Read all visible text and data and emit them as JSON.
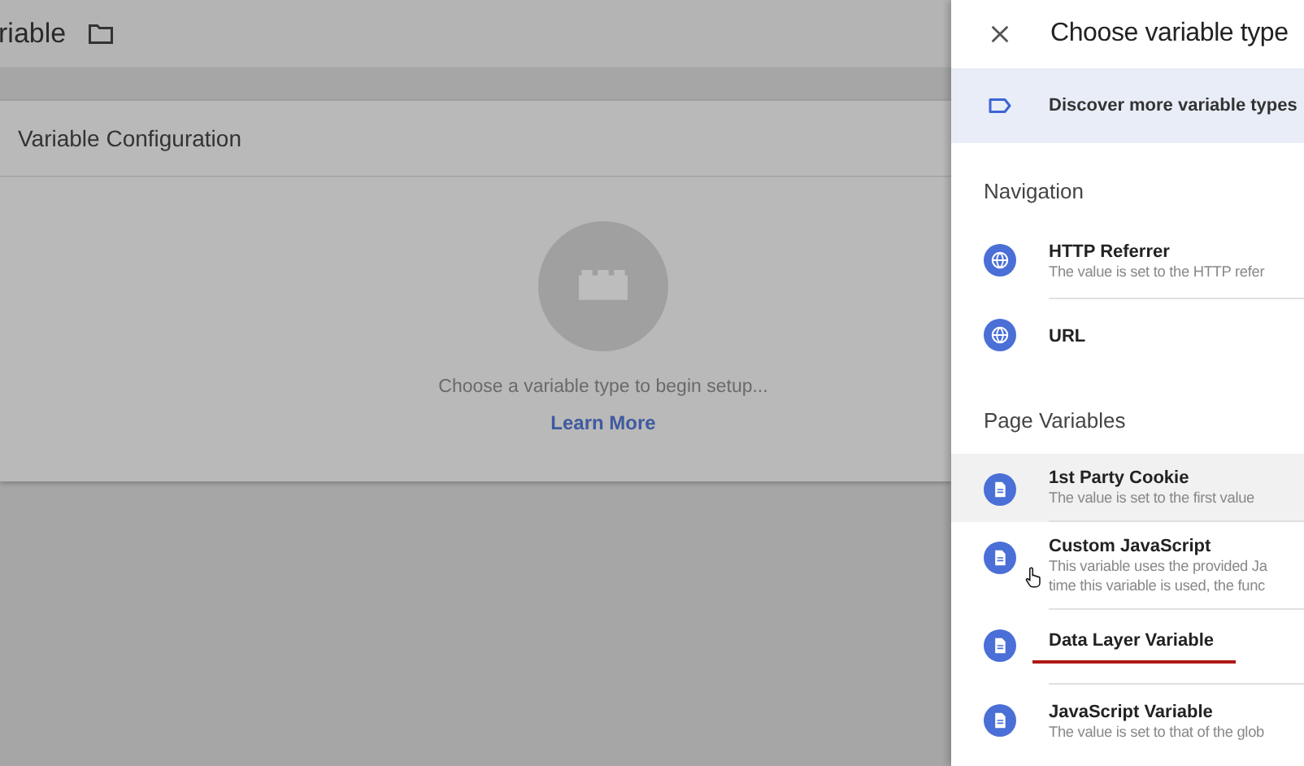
{
  "header": {
    "title": "riable"
  },
  "card": {
    "title": "Variable Configuration",
    "prompt": "Choose a variable type to begin setup...",
    "link": "Learn More"
  },
  "panel": {
    "title": "Choose variable type",
    "banner": "Discover more variable types",
    "sections": [
      {
        "heading": "Navigation",
        "items": [
          {
            "kind": "globe",
            "name": "HTTP Referrer",
            "description": [
              "The value is set to the HTTP refer"
            ],
            "hovered": false,
            "underlined": false,
            "pointer": false
          },
          {
            "kind": "globe",
            "name": "URL",
            "hovered": false,
            "underlined": false,
            "pointer": false
          }
        ]
      },
      {
        "heading": "Page Variables",
        "items": [
          {
            "kind": "document",
            "name": "1st Party Cookie",
            "description": [
              "The value is set to the first value"
            ],
            "hovered": true,
            "underlined": false,
            "pointer": false
          },
          {
            "kind": "document",
            "name": "Custom JavaScript",
            "description": [
              "This variable uses the provided Ja",
              "time this variable is used, the func"
            ],
            "hovered": false,
            "underlined": false,
            "pointer": true
          },
          {
            "kind": "document",
            "name": "Data Layer Variable",
            "hovered": false,
            "underlined": true,
            "pointer": false
          },
          {
            "kind": "document",
            "name": "JavaScript Variable",
            "description": [
              "The value is set to that of the glob"
            ],
            "hovered": false,
            "underlined": false,
            "pointer": false
          }
        ]
      }
    ]
  }
}
